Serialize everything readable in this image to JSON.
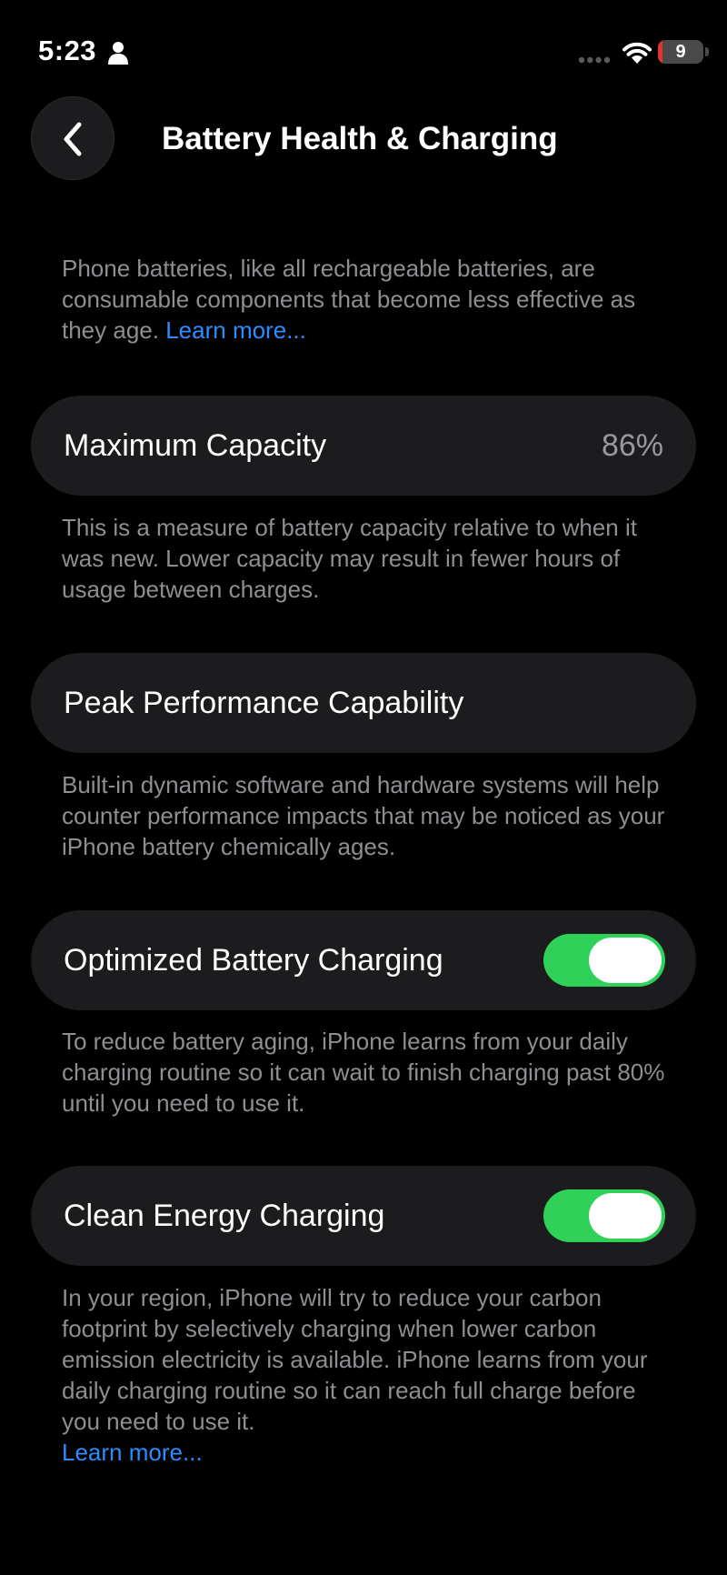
{
  "status_bar": {
    "time": "5:23",
    "battery_level": "9",
    "battery_fraction": 0.09
  },
  "nav": {
    "title": "Battery Health & Charging"
  },
  "intro": {
    "text": "Phone batteries, like all rechargeable batteries, are consumable components that become less effective as they age.",
    "link": "Learn more..."
  },
  "maximum_capacity": {
    "label": "Maximum Capacity",
    "value": "86%",
    "footnote": "This is a measure of battery capacity relative to when it was new. Lower capacity may result in fewer hours of usage between charges."
  },
  "peak_performance": {
    "label": "Peak Performance Capability",
    "footnote": "Built-in dynamic software and hardware systems will help counter performance impacts that may be noticed as your iPhone battery chemically ages."
  },
  "optimized_charging": {
    "label": "Optimized Battery Charging",
    "enabled": true,
    "footnote": "To reduce battery aging, iPhone learns from your daily charging routine so it can wait to finish charging past 80% until you need to use it."
  },
  "clean_energy": {
    "label": "Clean Energy Charging",
    "enabled": true,
    "footnote": "In your region, iPhone will try to reduce your carbon footprint by selectively charging when lower carbon emission electricity is available. iPhone learns from your daily charging routine so it can reach full charge before you need to use it.",
    "link": "Learn more..."
  },
  "colors": {
    "background": "#000000",
    "cell_background": "#1c1c1e",
    "secondary_text": "#8e8e93",
    "link": "#2f8cff",
    "toggle_on": "#30d158",
    "battery_low": "#e5332e"
  },
  "icons": {
    "back": "chevron-left-icon",
    "person": "person-icon",
    "signal": "cellular-dots-icon",
    "wifi": "wifi-icon",
    "battery": "battery-icon"
  }
}
